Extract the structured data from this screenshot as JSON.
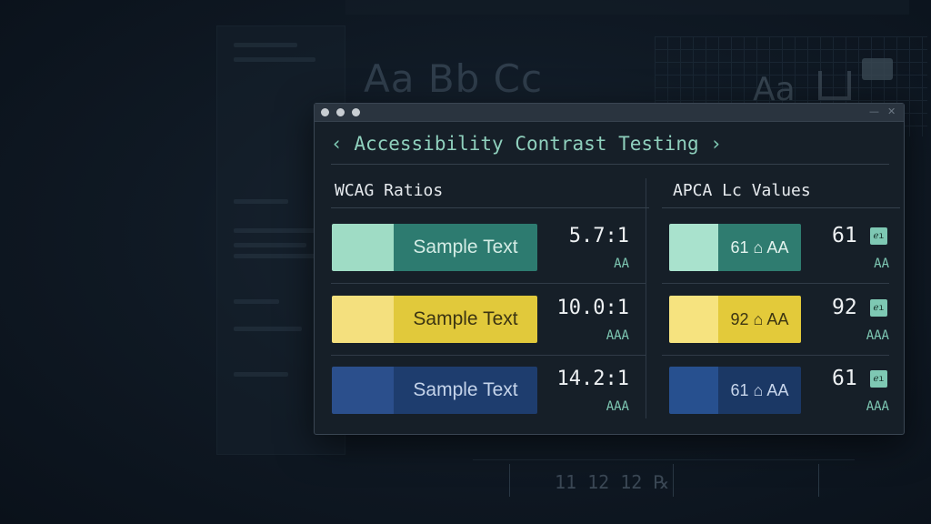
{
  "app": {
    "title": "Accessibility Contrast Testing",
    "back_glyph": "‹",
    "forward_glyph": "›"
  },
  "window_controls": {
    "minimize": "—",
    "close": "✕"
  },
  "background": {
    "big_text": "Aa Bb Cc",
    "corner_text": "Aa",
    "bottom_text": "11 12 12 ℞"
  },
  "wcag": {
    "title": "WCAG Ratios",
    "rows": [
      {
        "sample": "Sample Text",
        "ratio": "5.7:1",
        "level": "AA",
        "light": "#9fdcc5",
        "dark": "#2d7b70",
        "text_color": "#d4ece5"
      },
      {
        "sample": "Sample Text",
        "ratio": "10.0:1",
        "level": "AAA",
        "light": "#f4e07e",
        "dark": "#e1c93b",
        "text_color": "#3b3412"
      },
      {
        "sample": "Sample Text",
        "ratio": "14.2:1",
        "level": "AAA",
        "light": "#2b4f8c",
        "dark": "#1e3d6e",
        "text_color": "#c5d4ea"
      }
    ]
  },
  "apca": {
    "title": "APCA Lc Values",
    "rows": [
      {
        "label": "61 ⌂ AA",
        "lc": "61",
        "badge": "ℯı",
        "level": "AA",
        "light": "#a9e2cd",
        "dark": "#2f7c70",
        "text_color": "#e3f3ee"
      },
      {
        "label": "92 ⌂ AA",
        "lc": "92",
        "badge": "ℯı",
        "level": "AAA",
        "light": "#f6e37f",
        "dark": "#e3ca3a",
        "text_color": "#3b3412"
      },
      {
        "label": "61 ⌂ AA",
        "lc": "61",
        "badge": "ℯı",
        "level": "AAA",
        "light": "#27508f",
        "dark": "#1b3865",
        "text_color": "#c9d7ec"
      }
    ]
  },
  "colors": {
    "accent": "#7ec8b3",
    "window_bg": "#161f28",
    "titlebar": "#2a343f"
  }
}
